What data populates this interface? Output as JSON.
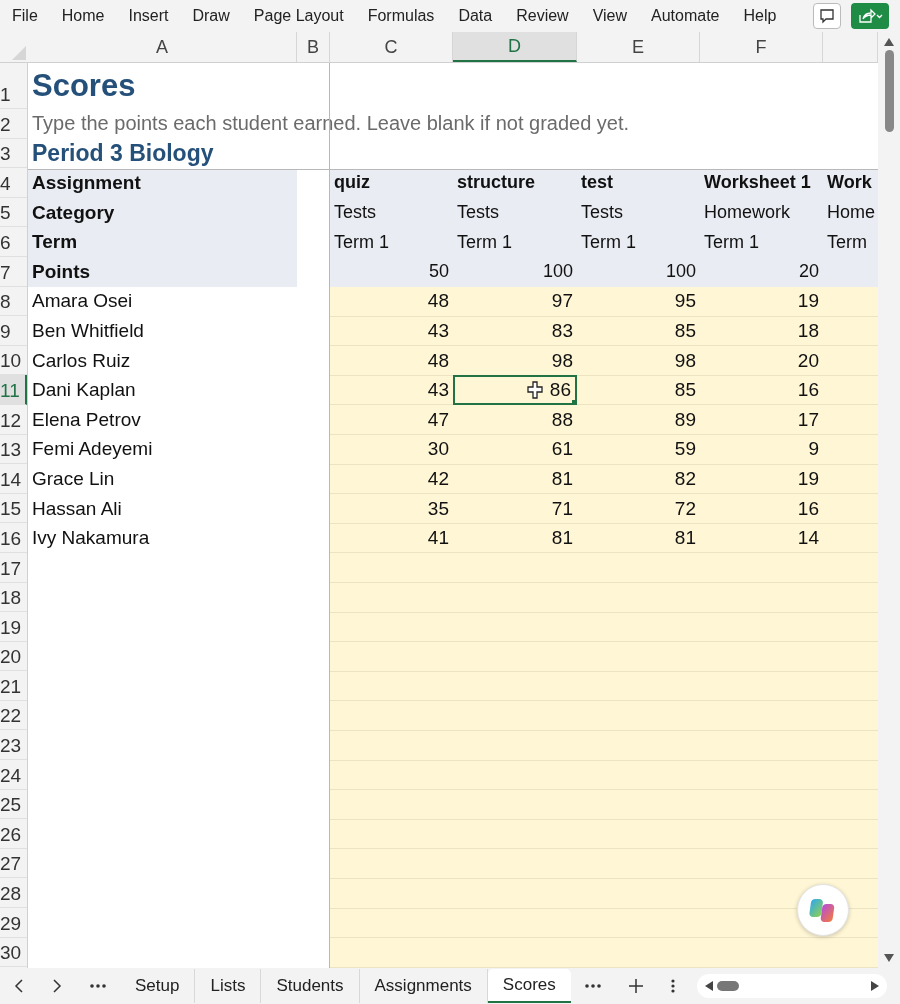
{
  "menu": [
    "File",
    "Home",
    "Insert",
    "Draw",
    "Page Layout",
    "Formulas",
    "Data",
    "Review",
    "View",
    "Automate",
    "Help"
  ],
  "columns": [
    {
      "label": "A",
      "selected": false
    },
    {
      "label": "B",
      "selected": false
    },
    {
      "label": "C",
      "selected": false
    },
    {
      "label": "D",
      "selected": true
    },
    {
      "label": "E",
      "selected": false
    },
    {
      "label": "F",
      "selected": false
    }
  ],
  "rows": [
    {
      "label": "1",
      "selected": false
    },
    {
      "label": "2",
      "selected": false
    },
    {
      "label": "3",
      "selected": false
    },
    {
      "label": "4",
      "selected": false
    },
    {
      "label": "5",
      "selected": false
    },
    {
      "label": "6",
      "selected": false
    },
    {
      "label": "7",
      "selected": false
    },
    {
      "label": "8",
      "selected": false
    },
    {
      "label": "9",
      "selected": false
    },
    {
      "label": "10",
      "selected": false
    },
    {
      "label": "11",
      "selected": true
    },
    {
      "label": "12",
      "selected": false
    },
    {
      "label": "13",
      "selected": false
    },
    {
      "label": "14",
      "selected": false
    },
    {
      "label": "15",
      "selected": false
    },
    {
      "label": "16",
      "selected": false
    },
    {
      "label": "17",
      "selected": false
    },
    {
      "label": "18",
      "selected": false
    },
    {
      "label": "19",
      "selected": false
    },
    {
      "label": "20",
      "selected": false
    },
    {
      "label": "21",
      "selected": false
    },
    {
      "label": "22",
      "selected": false
    },
    {
      "label": "23",
      "selected": false
    },
    {
      "label": "24",
      "selected": false
    },
    {
      "label": "25",
      "selected": false
    },
    {
      "label": "26",
      "selected": false
    },
    {
      "label": "27",
      "selected": false
    },
    {
      "label": "28",
      "selected": false
    },
    {
      "label": "29",
      "selected": false
    },
    {
      "label": "30",
      "selected": false
    }
  ],
  "title": "Scores",
  "subtitle": "Type the points each student earned. Leave blank if not graded yet.",
  "section": "Period 3 Biology",
  "header_labels": [
    "Assignment",
    "Category",
    "Term",
    "Points"
  ],
  "assignments": [
    {
      "name": "quiz",
      "category": "Tests",
      "term": "Term 1",
      "points": "50"
    },
    {
      "name": "structure",
      "category": "Tests",
      "term": "Term 1",
      "points": "100"
    },
    {
      "name": "test",
      "category": "Tests",
      "term": "Term 1",
      "points": "100"
    },
    {
      "name": "Worksheet 1",
      "category": "Homework",
      "term": "Term 1",
      "points": "20"
    },
    {
      "name": "Work",
      "category": "Home",
      "term": "Term"
    }
  ],
  "students": [
    {
      "name": "Amara Osei",
      "scores": [
        {
          "value": "48",
          "selected": false
        },
        {
          "value": "97",
          "selected": false
        },
        {
          "value": "95",
          "selected": false
        },
        {
          "value": "19",
          "selected": false
        }
      ]
    },
    {
      "name": "Ben Whitfield",
      "scores": [
        {
          "value": "43",
          "selected": false
        },
        {
          "value": "83",
          "selected": false
        },
        {
          "value": "85",
          "selected": false
        },
        {
          "value": "18",
          "selected": false
        }
      ]
    },
    {
      "name": "Carlos Ruiz",
      "scores": [
        {
          "value": "48",
          "selected": false
        },
        {
          "value": "98",
          "selected": false
        },
        {
          "value": "98",
          "selected": false
        },
        {
          "value": "20",
          "selected": false
        }
      ]
    },
    {
      "name": "Dani Kaplan",
      "scores": [
        {
          "value": "43",
          "selected": false
        },
        {
          "value": "86",
          "selected": true
        },
        {
          "value": "85",
          "selected": false
        },
        {
          "value": "16",
          "selected": false
        }
      ]
    },
    {
      "name": "Elena Petrov",
      "scores": [
        {
          "value": "47",
          "selected": false
        },
        {
          "value": "88",
          "selected": false
        },
        {
          "value": "89",
          "selected": false
        },
        {
          "value": "17",
          "selected": false
        }
      ]
    },
    {
      "name": "Femi Adeyemi",
      "scores": [
        {
          "value": "30",
          "selected": false
        },
        {
          "value": "61",
          "selected": false
        },
        {
          "value": "59",
          "selected": false
        },
        {
          "value": "9",
          "selected": false
        }
      ]
    },
    {
      "name": "Grace Lin",
      "scores": [
        {
          "value": "42",
          "selected": false
        },
        {
          "value": "81",
          "selected": false
        },
        {
          "value": "82",
          "selected": false
        },
        {
          "value": "19",
          "selected": false
        }
      ]
    },
    {
      "name": "Hassan Ali",
      "scores": [
        {
          "value": "35",
          "selected": false
        },
        {
          "value": "71",
          "selected": false
        },
        {
          "value": "72",
          "selected": false
        },
        {
          "value": "16",
          "selected": false
        }
      ]
    },
    {
      "name": "Ivy Nakamura",
      "scores": [
        {
          "value": "41",
          "selected": false
        },
        {
          "value": "81",
          "selected": false
        },
        {
          "value": "81",
          "selected": false
        },
        {
          "value": "14",
          "selected": false
        }
      ]
    }
  ],
  "sheets": [
    {
      "label": "Setup",
      "selected": false
    },
    {
      "label": "Lists",
      "selected": false
    },
    {
      "label": "Students",
      "selected": false
    },
    {
      "label": "Assignments",
      "selected": false
    },
    {
      "label": "Scores",
      "selected": true
    }
  ]
}
